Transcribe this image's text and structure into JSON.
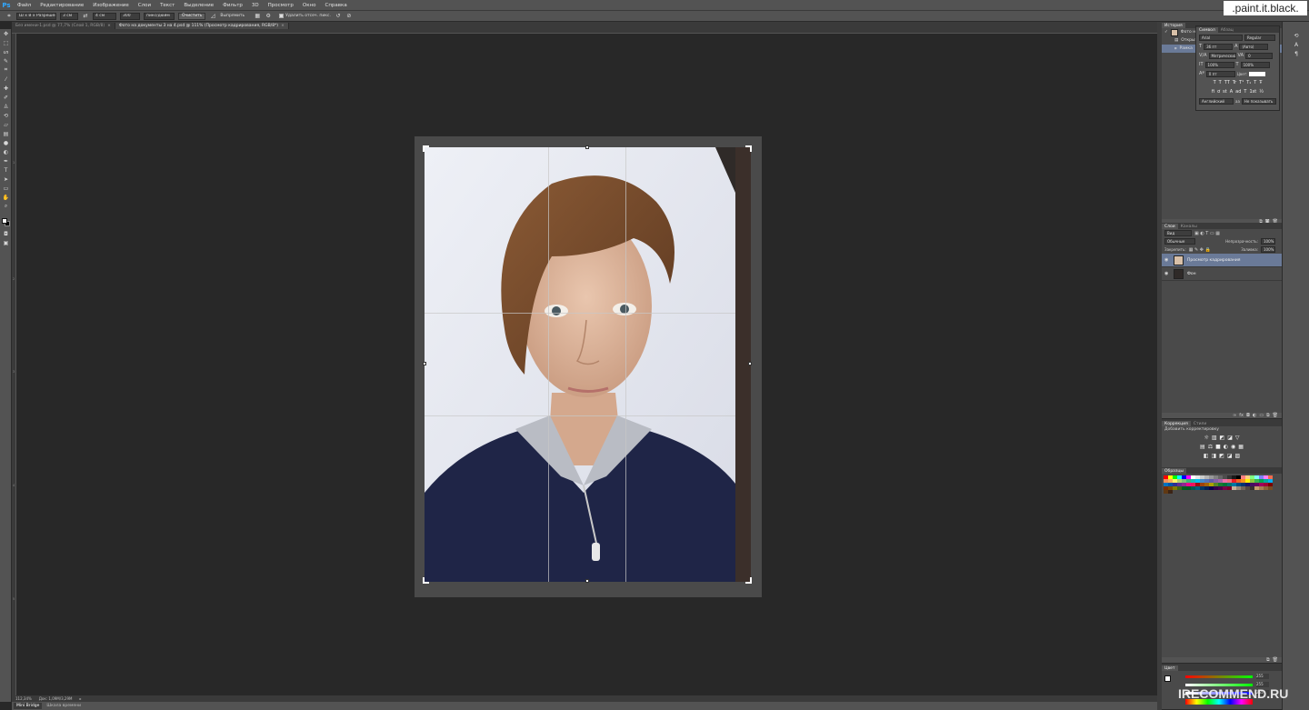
{
  "app": {
    "logo": "Ps"
  },
  "menu": [
    "Файл",
    "Редактирование",
    "Изображение",
    "Слои",
    "Текст",
    "Выделение",
    "Фильтр",
    "3D",
    "Просмотр",
    "Окно",
    "Справка"
  ],
  "options": {
    "ratio": "Ш x В x Разрешение",
    "width": "3 см",
    "height": "4 см",
    "resolution": "300",
    "resolution_unit": "пикс/дюйм",
    "clear_label": "Очистить",
    "straighten_label": "Выпрямить",
    "delete_pixels_label": "Удалить отсеч. пикс."
  },
  "tabs": [
    {
      "label": "Без имени-1.psd @ 77,7% (Слой 1, RGB/8)",
      "active": false
    },
    {
      "label": "Фото на документы 3 на 4.psd @ 111% (Просмотр кадрирования, RGB/8*)",
      "active": true
    }
  ],
  "rulers": {
    "left": [
      "1",
      "2",
      "3",
      "4",
      "5"
    ]
  },
  "status": {
    "zoom": "112,34%",
    "doc": "Док: 1,09М/3,29М"
  },
  "bottom_tabs": [
    {
      "label": "Mini Bridge",
      "active": true
    },
    {
      "label": "Шкала времени",
      "active": false
    }
  ],
  "history": {
    "tabs": [
      "История",
      "Символ",
      "Абзац"
    ],
    "items": [
      {
        "label": "Фото на ...",
        "selected": false
      },
      {
        "label": "Открыть",
        "selected": false
      },
      {
        "label": "Рамка",
        "selected": true
      }
    ]
  },
  "character": {
    "font": "Arial",
    "style": "Regular",
    "size": "36 пт",
    "leading": "(Авто)",
    "kerning": "Метрический",
    "tracking": "0",
    "vscale": "100%",
    "hscale": "100%",
    "baseline": "0 пт",
    "color_label": "Цвет:",
    "styles": [
      "T",
      "T",
      "TT",
      "Tr",
      "T¹",
      "T₁",
      "T",
      "Ŧ"
    ],
    "features": [
      "fi",
      "ơ",
      "st",
      "A",
      "ad",
      "T",
      "1st",
      "½"
    ],
    "language": "Английский",
    "aa_label": "aa",
    "aa": "Не показывать"
  },
  "layers": {
    "tabs": [
      "Слои",
      "Каналы"
    ],
    "kind": "Вид",
    "blend": "Обычные",
    "opacity_label": "Непрозрачность:",
    "opacity": "100%",
    "lock_label": "Закрепить:",
    "fill_label": "Заливка:",
    "fill": "100%",
    "items": [
      {
        "label": "Просмотр кадрирования",
        "selected": true
      },
      {
        "label": "Фон",
        "selected": false
      }
    ]
  },
  "adjustments": {
    "tabs": [
      "Коррекция",
      "Стили"
    ],
    "hint": "Добавить корректировку",
    "row1": [
      "☼",
      "▥",
      "◩",
      "◪",
      "▽"
    ],
    "row2": [
      "▤",
      "⚖",
      "■",
      "◐",
      "◉",
      "▦"
    ],
    "row3": [
      "◧",
      "◨",
      "◩",
      "◪",
      "▨"
    ]
  },
  "swatches": {
    "tabs": [
      "Образцы"
    ],
    "colors": [
      "#ff0000",
      "#ffff00",
      "#00ff00",
      "#00ffff",
      "#0000ff",
      "#ff00ff",
      "#ffffff",
      "#e6e6e6",
      "#cccccc",
      "#b3b3b3",
      "#999999",
      "#808080",
      "#666666",
      "#4d4d4d",
      "#333333",
      "#1a1a1a",
      "#000000",
      "#ff8080",
      "#ffd080",
      "#80ff80",
      "#80ffff",
      "#8080ff",
      "#ff80ff",
      "#f26c4f",
      "#f68e55",
      "#fbaf5d",
      "#fff467",
      "#acd372",
      "#7cc576",
      "#3bb878",
      "#1abbb4",
      "#00bff3",
      "#438ccb",
      "#5574b9",
      "#605ca8",
      "#855fa8",
      "#a763a8",
      "#f06ea9",
      "#f26d7d",
      "#ed1c24",
      "#f26522",
      "#f7941d",
      "#fff200",
      "#8dc73f",
      "#39b54a",
      "#00a651",
      "#00a99d",
      "#00aeef",
      "#0072bc",
      "#0054a6",
      "#2e3192",
      "#662d91",
      "#92278f",
      "#ec008c",
      "#ed145b",
      "#9e0b0f",
      "#a0410d",
      "#a36209",
      "#aba000",
      "#598527",
      "#1a7b30",
      "#007236",
      "#00746b",
      "#0076a3",
      "#004b80",
      "#003471",
      "#1b1464",
      "#440e62",
      "#630460",
      "#9e005d",
      "#9e0039",
      "#790000",
      "#7b2e00",
      "#7d4900",
      "#827b00",
      "#406618",
      "#005e20",
      "#005826",
      "#005952",
      "#005b7f",
      "#003663",
      "#002157",
      "#0d004c",
      "#32004b",
      "#4b0049",
      "#7b0046",
      "#7a0026",
      "#c7b299",
      "#998675",
      "#736357",
      "#534741",
      "#37302d",
      "#c69c6d",
      "#a67c52",
      "#8c6239",
      "#754c24",
      "#603913",
      "#3c2415"
    ]
  },
  "color_panel": {
    "tabs": [
      "Цвет"
    ],
    "sliders": [
      "255",
      "255",
      "255"
    ]
  },
  "watermarks": {
    "top": ".paint.it.black.",
    "bottom": "IRECOMMEND.RU"
  }
}
